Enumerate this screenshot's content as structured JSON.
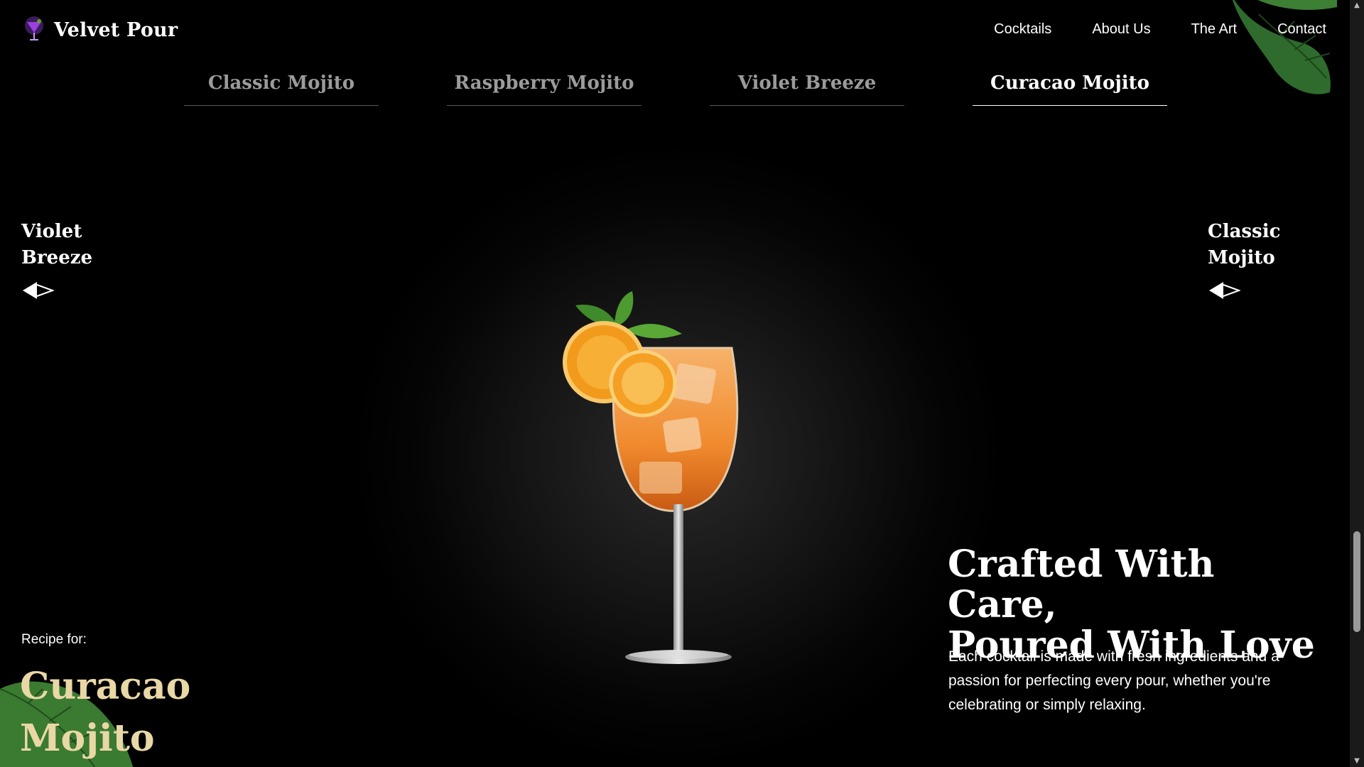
{
  "brand": {
    "name": "Velvet Pour",
    "icon": "cocktail-glass-icon"
  },
  "nav": {
    "items": [
      {
        "label": "Cocktails"
      },
      {
        "label": "About Us"
      },
      {
        "label": "The Art"
      },
      {
        "label": "Contact"
      }
    ]
  },
  "tabs": [
    {
      "label": "Classic Mojito",
      "active": false
    },
    {
      "label": "Raspberry Mojito",
      "active": false
    },
    {
      "label": "Violet Breeze",
      "active": false
    },
    {
      "label": "Curacao Mojito",
      "active": true
    }
  ],
  "prev": {
    "line1": "Violet",
    "line2": "Breeze",
    "icon": "arrow-left-icon"
  },
  "next": {
    "line1": "Classic",
    "line2": "Mojito",
    "icon": "arrow-left-icon"
  },
  "recipe": {
    "label": "Recipe for:",
    "name_line1": "Curacao",
    "name_line2": "Mojito"
  },
  "headline": {
    "line1": "Crafted With Care,",
    "line2": "Poured With Love"
  },
  "description": "Each cocktail is made with fresh ingredients and a passion for perfecting every pour, whether you're celebrating or simply relaxing.",
  "colors": {
    "background": "#000000",
    "accent_gold": "#e9d8a6",
    "inactive_tab": "#9b9b9b"
  },
  "scrollbar": {
    "up_glyph": "▲",
    "down_glyph": "▼"
  }
}
